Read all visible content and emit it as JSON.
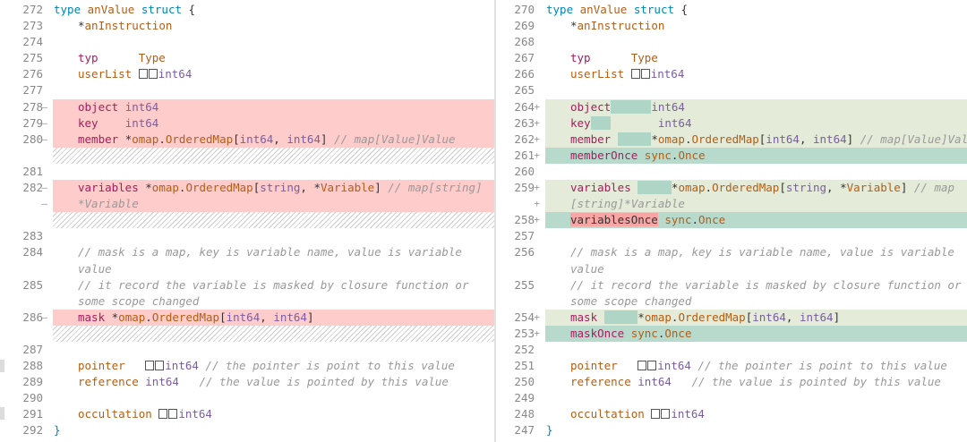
{
  "left": {
    "rows": [
      {
        "num": "272",
        "mk": "",
        "type": "plain",
        "code": [
          [
            "kw",
            "type "
          ],
          [
            "fld",
            "anValue "
          ],
          [
            "kw",
            "struct "
          ],
          [
            "",
            "{"
          ]
        ],
        "ind": false
      },
      {
        "num": "273",
        "mk": "",
        "type": "plain",
        "code": [
          [
            "",
            "*"
          ],
          [
            "fld",
            "anInstruction"
          ]
        ],
        "ind": true
      },
      {
        "num": "274",
        "mk": "",
        "type": "plain",
        "code": [],
        "ind": true
      },
      {
        "num": "275",
        "mk": "",
        "type": "plain",
        "code": [
          [
            "ty",
            "typ      "
          ],
          [
            "fld",
            "Type"
          ]
        ],
        "ind": true
      },
      {
        "num": "276",
        "mk": "",
        "type": "plain",
        "code": [
          [
            "fld",
            "userList "
          ],
          [
            "sq",
            ""
          ],
          [
            "sq",
            ""
          ],
          [
            "pk",
            "int64"
          ]
        ],
        "ind": true
      },
      {
        "num": "277",
        "mk": "",
        "type": "plain",
        "code": [],
        "ind": true
      },
      {
        "num": "278",
        "mk": "–",
        "type": "del",
        "code": [
          [
            "ty",
            "object"
          ],
          [
            "",
            " "
          ],
          [
            "pk",
            "int64"
          ]
        ],
        "ind": true
      },
      {
        "num": "279",
        "mk": "–",
        "type": "del",
        "code": [
          [
            "ty",
            "key    "
          ],
          [
            "pk",
            "int64"
          ]
        ],
        "ind": true
      },
      {
        "num": "280",
        "mk": "–",
        "type": "del",
        "code": [
          [
            "ty",
            "member "
          ],
          [
            "",
            "*"
          ],
          [
            "fld",
            "omap"
          ],
          [
            "",
            "."
          ],
          [
            "fld",
            "OrderedMap"
          ],
          [
            "",
            "["
          ],
          [
            "pk",
            "int64"
          ],
          [
            "",
            ", "
          ],
          [
            "pk",
            "int64"
          ],
          [
            "",
            "] "
          ],
          [
            "cm",
            "// map[Value]Value"
          ]
        ],
        "ind": true
      },
      {
        "num": "",
        "mk": "",
        "type": "hatch",
        "code": [],
        "ind": true
      },
      {
        "num": "281",
        "mk": "",
        "type": "plain",
        "code": [],
        "ind": true
      },
      {
        "num": "282",
        "mk": "–",
        "type": "del",
        "code": [
          [
            "ty",
            "variables "
          ],
          [
            "",
            "*"
          ],
          [
            "fld",
            "omap"
          ],
          [
            "",
            "."
          ],
          [
            "fld",
            "OrderedMap"
          ],
          [
            "",
            "["
          ],
          [
            "pk",
            "string"
          ],
          [
            "",
            ", *"
          ],
          [
            "fld",
            "Variable"
          ],
          [
            "",
            "] "
          ],
          [
            "cm",
            "// map[string]"
          ]
        ],
        "ind": true
      },
      {
        "num": "",
        "mk": "–",
        "type": "del",
        "code": [
          [
            "cm",
            "*Variable"
          ]
        ],
        "ind": true
      },
      {
        "num": "",
        "mk": "",
        "type": "hatch",
        "code": [],
        "ind": true
      },
      {
        "num": "283",
        "mk": "",
        "type": "plain",
        "code": [],
        "ind": true
      },
      {
        "num": "284",
        "mk": "",
        "type": "plain",
        "code": [
          [
            "cm",
            "// mask is a map, key is variable name, value is variable"
          ]
        ],
        "ind": true
      },
      {
        "num": "",
        "mk": "",
        "type": "plain",
        "code": [
          [
            "cm",
            "value"
          ]
        ],
        "ind": true
      },
      {
        "num": "285",
        "mk": "",
        "type": "plain",
        "code": [
          [
            "cm",
            "// it record the variable is masked by closure function or"
          ]
        ],
        "ind": true
      },
      {
        "num": "",
        "mk": "",
        "type": "plain",
        "code": [
          [
            "cm",
            "some scope changed"
          ]
        ],
        "ind": true
      },
      {
        "num": "286",
        "mk": "–",
        "type": "del",
        "code": [
          [
            "ty",
            "mask "
          ],
          [
            "",
            "*"
          ],
          [
            "fld",
            "omap"
          ],
          [
            "",
            "."
          ],
          [
            "fld",
            "OrderedMap"
          ],
          [
            "",
            "["
          ],
          [
            "pk",
            "int64"
          ],
          [
            "",
            ", "
          ],
          [
            "pk",
            "int64"
          ],
          [
            "",
            "]"
          ]
        ],
        "ind": true
      },
      {
        "num": "",
        "mk": "",
        "type": "hatch",
        "code": [],
        "ind": true
      },
      {
        "num": "287",
        "mk": "",
        "type": "plain",
        "code": [],
        "ind": true
      },
      {
        "num": "288",
        "mk": "",
        "type": "plain",
        "code": [
          [
            "fld",
            "pointer   "
          ],
          [
            "sq",
            ""
          ],
          [
            "sq",
            ""
          ],
          [
            "pk",
            "int64 "
          ],
          [
            "cm",
            "// the pointer is point to this value"
          ]
        ],
        "ind": true
      },
      {
        "num": "289",
        "mk": "",
        "type": "plain",
        "code": [
          [
            "fld",
            "reference "
          ],
          [
            "pk",
            "int64   "
          ],
          [
            "cm",
            "// the value is pointed by this value"
          ]
        ],
        "ind": true
      },
      {
        "num": "290",
        "mk": "",
        "type": "plain",
        "code": [],
        "ind": true
      },
      {
        "num": "291",
        "mk": "",
        "type": "plain",
        "code": [
          [
            "fld",
            "occultation "
          ],
          [
            "sq",
            ""
          ],
          [
            "sq",
            ""
          ],
          [
            "pk",
            "int64"
          ]
        ],
        "ind": true
      },
      {
        "num": "292",
        "mk": "",
        "type": "plain",
        "code": [
          [
            "kw",
            "}"
          ]
        ],
        "ind": false
      }
    ]
  },
  "right": {
    "rows": [
      {
        "num": "270",
        "mk": "",
        "type": "plain",
        "code": [
          [
            "kw",
            "type "
          ],
          [
            "fld",
            "anValue "
          ],
          [
            "kw",
            "struct "
          ],
          [
            "",
            "{"
          ]
        ],
        "ind": false
      },
      {
        "num": "269",
        "mk": "",
        "type": "plain",
        "code": [
          [
            "",
            "*"
          ],
          [
            "fld",
            "anInstruction"
          ]
        ],
        "ind": true
      },
      {
        "num": "268",
        "mk": "",
        "type": "plain",
        "code": [],
        "ind": true
      },
      {
        "num": "267",
        "mk": "",
        "type": "plain",
        "code": [
          [
            "ty",
            "typ      "
          ],
          [
            "fld",
            "Type"
          ]
        ],
        "ind": true
      },
      {
        "num": "266",
        "mk": "",
        "type": "plain",
        "code": [
          [
            "fld",
            "userList "
          ],
          [
            "sq",
            ""
          ],
          [
            "sq",
            ""
          ],
          [
            "pk",
            "int64"
          ]
        ],
        "ind": true
      },
      {
        "num": "265",
        "mk": "",
        "type": "plain",
        "code": [],
        "ind": true
      },
      {
        "num": "264",
        "mk": "+",
        "type": "add",
        "code": [
          [
            "ty",
            "object"
          ],
          [
            "hl-add",
            "      "
          ],
          [
            "pk",
            "int64"
          ]
        ],
        "ind": true
      },
      {
        "num": "263",
        "mk": "+",
        "type": "add",
        "code": [
          [
            "ty",
            "key"
          ],
          [
            "hl-add",
            "   "
          ],
          [
            "",
            "       "
          ],
          [
            "pk",
            "int64"
          ]
        ],
        "ind": true
      },
      {
        "num": "262",
        "mk": "+",
        "type": "add",
        "code": [
          [
            "ty",
            "member "
          ],
          [
            "hl-add",
            "     "
          ],
          [
            "",
            "*"
          ],
          [
            "fld",
            "omap"
          ],
          [
            "",
            "."
          ],
          [
            "fld",
            "OrderedMap"
          ],
          [
            "",
            "["
          ],
          [
            "pk",
            "int64"
          ],
          [
            "",
            ", "
          ],
          [
            "pk",
            "int64"
          ],
          [
            "",
            "] "
          ],
          [
            "cm",
            "// map[Value]Value"
          ]
        ],
        "ind": true
      },
      {
        "num": "261",
        "mk": "+",
        "type": "add2",
        "code": [
          [
            "ty",
            "memberOnce "
          ],
          [
            "fld",
            "sync"
          ],
          [
            "",
            "."
          ],
          [
            "fld",
            "Once"
          ]
        ],
        "ind": true
      },
      {
        "num": "260",
        "mk": "",
        "type": "plain",
        "code": [],
        "ind": true
      },
      {
        "num": "259",
        "mk": "+",
        "type": "add",
        "code": [
          [
            "ty",
            "variables "
          ],
          [
            "hl-add",
            "     "
          ],
          [
            "",
            "*"
          ],
          [
            "fld",
            "omap"
          ],
          [
            "",
            "."
          ],
          [
            "fld",
            "OrderedMap"
          ],
          [
            "",
            "["
          ],
          [
            "pk",
            "string"
          ],
          [
            "",
            ", *"
          ],
          [
            "fld",
            "Variable"
          ],
          [
            "",
            "] "
          ],
          [
            "cm",
            "// map"
          ]
        ],
        "ind": true
      },
      {
        "num": "",
        "mk": "+",
        "type": "add",
        "code": [
          [
            "cm",
            "[string]*Variable"
          ]
        ],
        "ind": true
      },
      {
        "num": "258",
        "mk": "+",
        "type": "add2",
        "code": [
          [
            "hl-del",
            "variablesOnce"
          ],
          [
            "",
            " "
          ],
          [
            "fld",
            "sync"
          ],
          [
            "",
            "."
          ],
          [
            "fld",
            "Once"
          ]
        ],
        "ind": true
      },
      {
        "num": "257",
        "mk": "",
        "type": "plain",
        "code": [],
        "ind": true
      },
      {
        "num": "256",
        "mk": "",
        "type": "plain",
        "code": [
          [
            "cm",
            "// mask is a map, key is variable name, value is variable"
          ]
        ],
        "ind": true
      },
      {
        "num": "",
        "mk": "",
        "type": "plain",
        "code": [
          [
            "cm",
            "value"
          ]
        ],
        "ind": true
      },
      {
        "num": "255",
        "mk": "",
        "type": "plain",
        "code": [
          [
            "cm",
            "// it record the variable is masked by closure function or"
          ]
        ],
        "ind": true
      },
      {
        "num": "",
        "mk": "",
        "type": "plain",
        "code": [
          [
            "cm",
            "some scope changed"
          ]
        ],
        "ind": true
      },
      {
        "num": "254",
        "mk": "+",
        "type": "add",
        "code": [
          [
            "ty",
            "mask "
          ],
          [
            "hl-add",
            "     "
          ],
          [
            "",
            "*"
          ],
          [
            "fld",
            "omap"
          ],
          [
            "",
            "."
          ],
          [
            "fld",
            "OrderedMap"
          ],
          [
            "",
            "["
          ],
          [
            "pk",
            "int64"
          ],
          [
            "",
            ", "
          ],
          [
            "pk",
            "int64"
          ],
          [
            "",
            "]"
          ]
        ],
        "ind": true
      },
      {
        "num": "253",
        "mk": "+",
        "type": "add2",
        "code": [
          [
            "ty",
            "maskOnce "
          ],
          [
            "fld",
            "sync"
          ],
          [
            "",
            "."
          ],
          [
            "fld",
            "Once"
          ]
        ],
        "ind": true
      },
      {
        "num": "252",
        "mk": "",
        "type": "plain",
        "code": [],
        "ind": true
      },
      {
        "num": "251",
        "mk": "",
        "type": "plain",
        "code": [
          [
            "fld",
            "pointer   "
          ],
          [
            "sq",
            ""
          ],
          [
            "sq",
            ""
          ],
          [
            "pk",
            "int64 "
          ],
          [
            "cm",
            "// the pointer is point to this value"
          ]
        ],
        "ind": true
      },
      {
        "num": "250",
        "mk": "",
        "type": "plain",
        "code": [
          [
            "fld",
            "reference "
          ],
          [
            "pk",
            "int64   "
          ],
          [
            "cm",
            "// the value is pointed by this value"
          ]
        ],
        "ind": true
      },
      {
        "num": "249",
        "mk": "",
        "type": "plain",
        "code": [],
        "ind": true
      },
      {
        "num": "248",
        "mk": "",
        "type": "plain",
        "code": [
          [
            "fld",
            "occultation "
          ],
          [
            "sq",
            ""
          ],
          [
            "sq",
            ""
          ],
          [
            "pk",
            "int64"
          ]
        ],
        "ind": true
      },
      {
        "num": "247",
        "mk": "",
        "type": "plain",
        "code": [
          [
            "kw",
            "}"
          ]
        ],
        "ind": false
      }
    ]
  },
  "colors": {
    "deleted_line": "#fecccb",
    "added_line": "#e4ebd9",
    "added_new_line": "#b8dacd",
    "keyword": "#0086b3",
    "field": "#b35e14",
    "type_name": "#795da3",
    "comment": "#999999"
  }
}
